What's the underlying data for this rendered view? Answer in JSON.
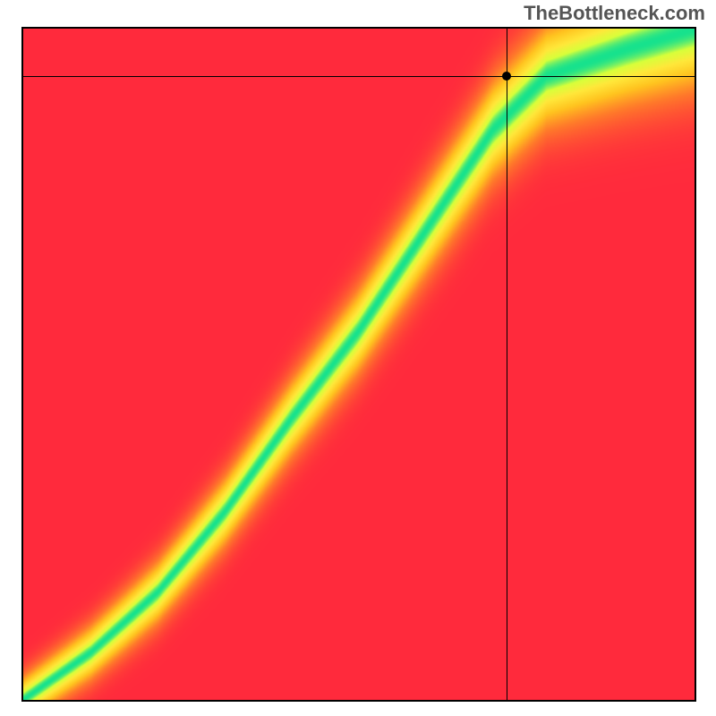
{
  "watermark": "TheBottleneck.com",
  "chart_data": {
    "type": "heatmap",
    "title": "",
    "xlabel": "",
    "ylabel": "",
    "xlim": [
      0,
      1
    ],
    "ylim": [
      0,
      1
    ],
    "crosshair": {
      "x": 0.72,
      "y": 0.93
    },
    "description": "Heatmap showing optimal balance ridge (green) between two components; red indicates strong bottleneck, yellow/orange moderate, green optimal. Ridge curves from bottom-left toward upper-right with slight S-shape.",
    "ridge_points": [
      {
        "x": 0.0,
        "y": 0.0
      },
      {
        "x": 0.1,
        "y": 0.07
      },
      {
        "x": 0.2,
        "y": 0.16
      },
      {
        "x": 0.3,
        "y": 0.28
      },
      {
        "x": 0.4,
        "y": 0.42
      },
      {
        "x": 0.5,
        "y": 0.55
      },
      {
        "x": 0.6,
        "y": 0.7
      },
      {
        "x": 0.7,
        "y": 0.85
      },
      {
        "x": 0.78,
        "y": 0.93
      },
      {
        "x": 0.9,
        "y": 0.97
      },
      {
        "x": 1.0,
        "y": 1.0
      }
    ],
    "color_stops": [
      {
        "t": 0.0,
        "color": "#ff2a3c"
      },
      {
        "t": 0.35,
        "color": "#ff7a2a"
      },
      {
        "t": 0.6,
        "color": "#ffc31f"
      },
      {
        "t": 0.8,
        "color": "#ffe83a"
      },
      {
        "t": 0.92,
        "color": "#d8ff3a"
      },
      {
        "t": 1.0,
        "color": "#17e28d"
      }
    ]
  }
}
